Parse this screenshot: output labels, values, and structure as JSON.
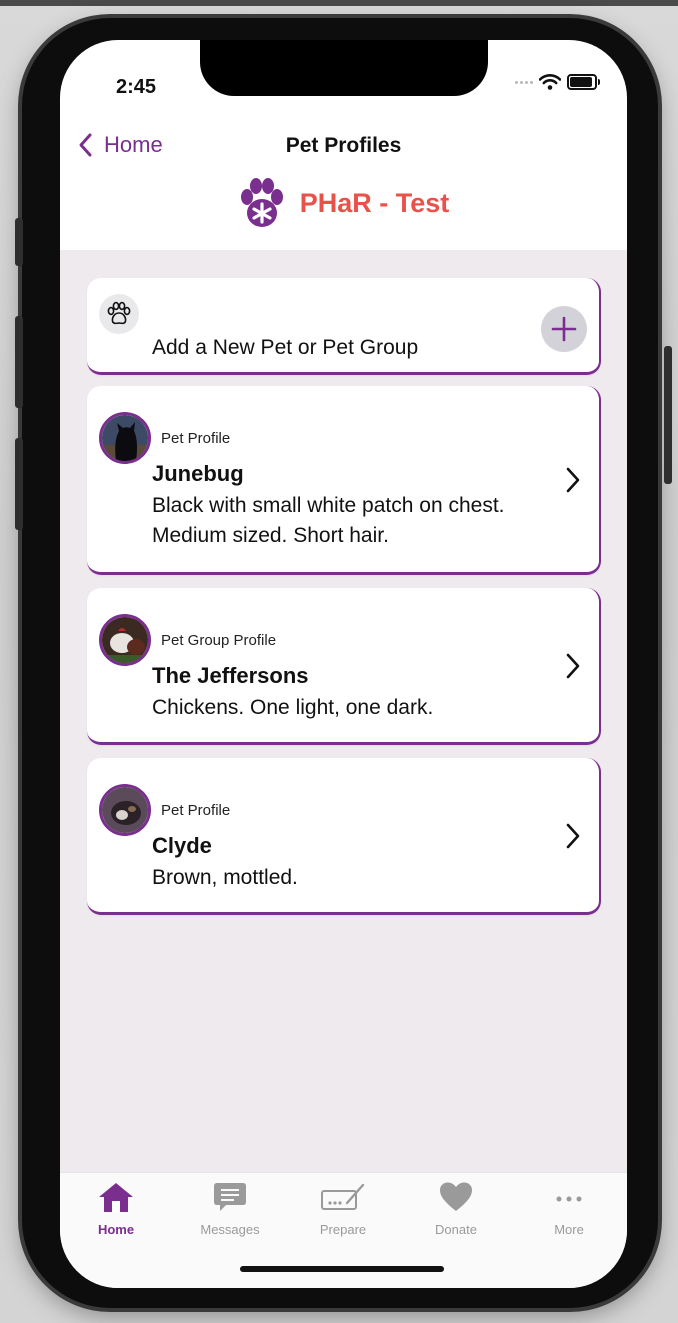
{
  "status_bar": {
    "time": "2:45"
  },
  "nav": {
    "back_label": "Home",
    "title": "Pet Profiles"
  },
  "brand": {
    "name": "PHaR - Test",
    "icon": "paw-icon",
    "color": "#e8524a"
  },
  "accent_color": "#7a2e8e",
  "add_card": {
    "label": "Add a New Pet or Pet Group",
    "icon": "paw-icon",
    "action_icon": "plus-icon"
  },
  "pets": [
    {
      "type": "Pet Profile",
      "name": "Junebug",
      "description": "Black with small white patch on chest. Medium sized. Short hair."
    },
    {
      "type": "Pet Group Profile",
      "name": "The Jeffersons",
      "description": "Chickens. One light, one dark."
    },
    {
      "type": "Pet Profile",
      "name": "Clyde",
      "description": "Brown, mottled."
    }
  ],
  "tabs": [
    {
      "label": "Home",
      "icon": "home-icon",
      "active": true
    },
    {
      "label": "Messages",
      "icon": "message-icon",
      "active": false
    },
    {
      "label": "Prepare",
      "icon": "prepare-icon",
      "active": false
    },
    {
      "label": "Donate",
      "icon": "heart-icon",
      "active": false
    },
    {
      "label": "More",
      "icon": "more-icon",
      "active": false
    }
  ]
}
